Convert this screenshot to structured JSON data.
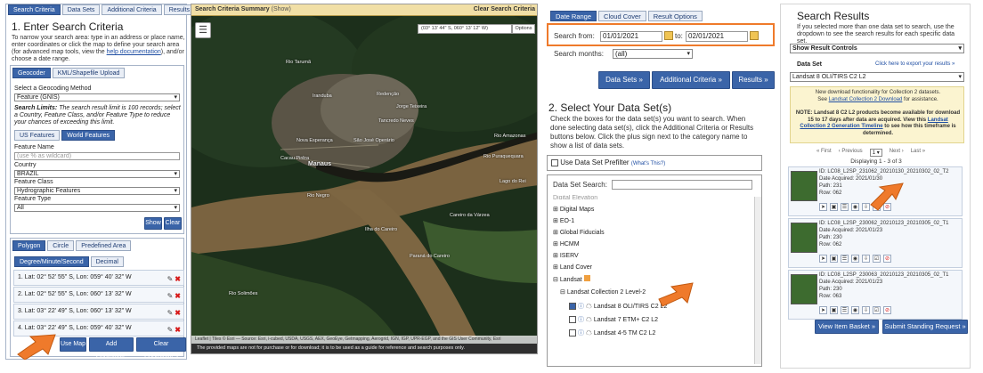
{
  "p1": {
    "tabs": [
      "Search Criteria",
      "Data Sets",
      "Additional Criteria",
      "Results"
    ],
    "heading": "1. Enter Search Criteria",
    "intro": "To narrow your search area: type in an address or place name, enter coordinates or click the map to define your search area (for advanced map tools, view the",
    "intro_link": "help documentation",
    "intro_end": "), and/or choose a date range.",
    "geo_tabs": [
      "Geocoder",
      "KML/Shapefile Upload"
    ],
    "method_label": "Select a Geocoding Method",
    "method_value": "Feature (GNIS)",
    "limits_bold": "Search Limits:",
    "limits_text": "The search result limit is 100 records; select a Country, Feature Class, and/or Feature Type to reduce your chances of exceeding this limit.",
    "feature_tabs": [
      "US Features",
      "World Features"
    ],
    "feature_name_label": "Feature Name",
    "feature_name_placeholder": "(use % as wildcard)",
    "country_label": "Country",
    "country_value": "BRAZIL",
    "class_label": "Feature Class",
    "class_value": "Hydrographic Features",
    "type_label": "Feature Type",
    "type_value": "All",
    "show_btn": "Show",
    "clear_btn": "Clear",
    "shape_tabs": [
      "Polygon",
      "Circle",
      "Predefined Area"
    ],
    "coord_tabs": [
      "Degree/Minute/Second",
      "Decimal"
    ],
    "coords": [
      "1.  Lat: 02° 52' 55\" S, Lon: 059° 40' 32\" W",
      "2.  Lat: 02° 52' 55\" S, Lon: 060° 13' 32\" W",
      "3.  Lat: 03° 22' 49\" S, Lon: 060° 13' 32\" W",
      "4.  Lat: 03° 22' 49\" S, Lon: 059° 40' 32\" W"
    ],
    "use_map_btn": "Use Map",
    "add_coord_btn": "Add Coordinate",
    "clear_coords_btn": "Clear Coordinates"
  },
  "p2": {
    "bar_title": "Search Criteria Summary",
    "bar_show": "(Show)",
    "bar_clear": "Clear Search Criteria",
    "coord_readout": "(03° 13' 44\" S, 060° 13' 12\" W)",
    "options": "Options",
    "labels": [
      "Iranduba",
      "Manaus",
      "Cacau Pirêra",
      "Careiro da Várzea",
      "Nova Esperança",
      "São José Operário",
      "Tancredo Neves",
      "Lago do Rei",
      "Rio Solimões",
      "Rio Amazonas",
      "Rio Negro",
      "Paraná do Careiro",
      "Ilha do Careiro",
      "Jorge Teixeira",
      "Redenção",
      "Rio Tarumã",
      "Rio Puraquequara"
    ],
    "attribution": "Leaflet | Tiles © Esri — Source: Esri, i-cubed, USDA, USGS, AEX, GeoEye, Getmapping, Aerogrid, IGN, IGP, UPR-EGP, and the GIS User Community, Esri",
    "footer": "The provided maps are not for purchase or for download; it is to be used as a guide for reference and search purposes only."
  },
  "p3": {
    "tabs": [
      "Date Range",
      "Cloud Cover",
      "Result Options"
    ],
    "from_label": "Search from:",
    "from_value": "01/01/2021",
    "to_label": "to:",
    "to_value": "02/01/2021",
    "months_label": "Search months:",
    "months_value": "(all)",
    "data_sets_btn": "Data Sets »",
    "additional_btn": "Additional Criteria »",
    "results_btn": "Results »",
    "heading": "2. Select Your Data Set(s)",
    "instructions": "Check the boxes for the data set(s) you want to search. When done selecting data set(s), click the Additional Criteria or Results buttons below. Click the plus sign next to the category name to show a list of data sets.",
    "prefilter_label": "Use Data Set Prefilter",
    "prefilter_link": "(What's This?)",
    "search_label": "Data Set Search:",
    "tree": [
      "Digital Elevation",
      "Digital Maps",
      "EO-1",
      "Global Fiducials",
      "HCMM",
      "ISERV",
      "Land Cover",
      "Landsat"
    ],
    "collection": "Landsat Collection 2 Level-2",
    "datasets": [
      "Landsat 8 OLI/TIRS C2 L2",
      "Landsat 7 ETM+ C2 L2",
      "Landsat 4-5 TM C2 L2"
    ]
  },
  "p4": {
    "heading": "Search Results",
    "intro": "If you selected more than one data set to search, use the dropdown to see the search results for each specific data set.",
    "controls_label": "Show Result Controls",
    "dataset_label": "Data Set",
    "export_link": "Click here to export your results »",
    "dataset_value": "Landsat 8 OLI/TIRS C2 L2",
    "notice1": "New download functionality for Collection 2 datasets.",
    "notice2_pre": "See",
    "notice2_link": "Landsat Collection 2 Download",
    "notice2_post": "for assistance.",
    "note": "NOTE: Landsat 8 C2 L2 products become available for download 15 to 17 days after data are acquired. View this",
    "note_link": "Landsat Collection 2 Generation Timeline",
    "note_end": "to see how this timeframe is determined.",
    "pager_first": "« First",
    "pager_prev": "‹ Previous",
    "pager_next": "Next ›",
    "pager_last": "Last »",
    "displaying": "Displaying 1 - 3 of 3",
    "results": [
      {
        "id": "ID: LC08_L2SP_231062_20210130_20210302_02_T2",
        "date": "Date Acquired: 2021/01/30",
        "path": "Path: 231",
        "row": "Row: 062"
      },
      {
        "id": "ID: LC08_L2SP_230062_20210123_20210305_02_T1",
        "date": "Date Acquired: 2021/01/23",
        "path": "Path: 230",
        "row": "Row: 062"
      },
      {
        "id": "ID: LC08_L2SP_230063_20210123_20210305_02_T1",
        "date": "Date Acquired: 2021/01/23",
        "path": "Path: 230",
        "row": "Row: 063"
      }
    ],
    "basket_btn": "View Item Basket »",
    "standing_btn": "Submit Standing Request »"
  },
  "colors": {
    "accent": "#3a64a8",
    "arrow": "#ef7a2b",
    "close": "#d71919"
  }
}
